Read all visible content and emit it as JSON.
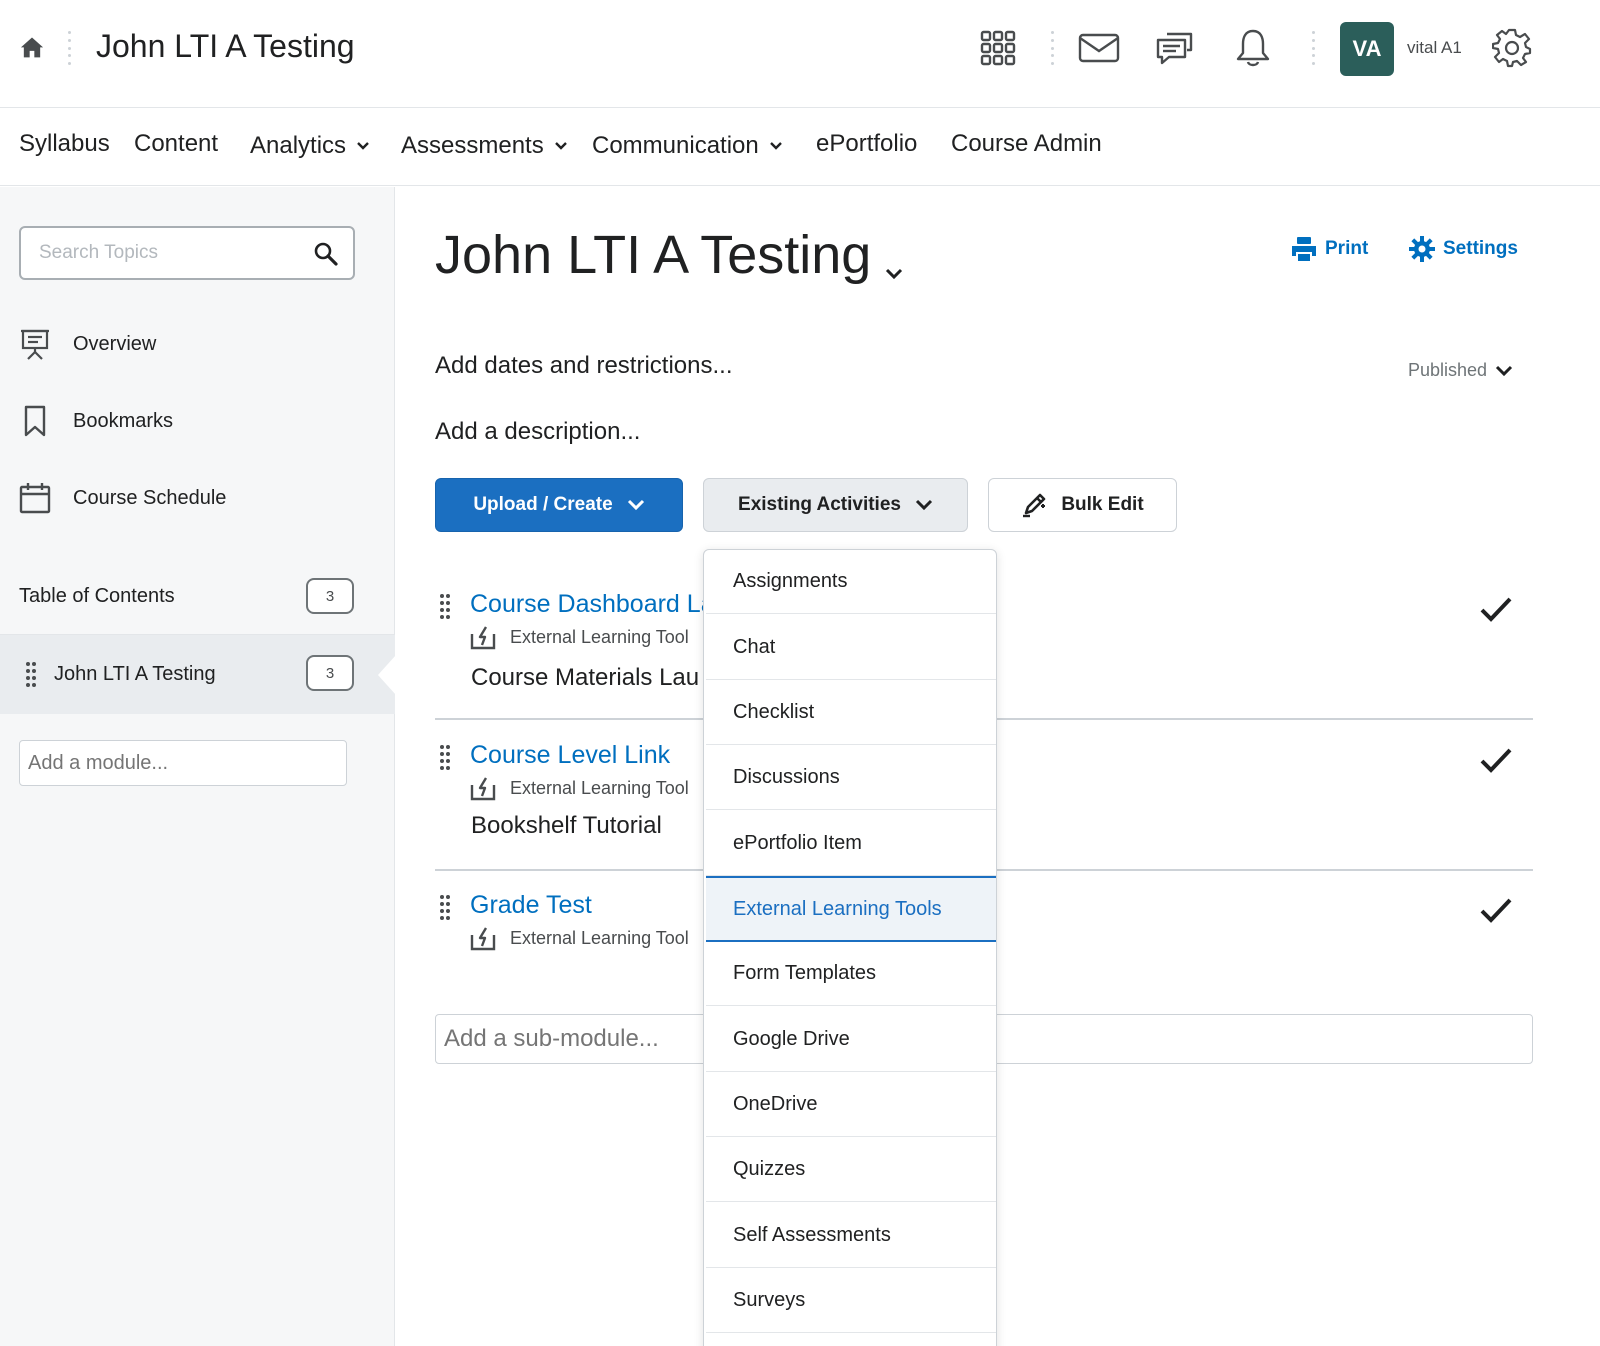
{
  "header": {
    "course_title": "John LTI A Testing",
    "avatar_initials": "VA",
    "user_name": "vital A1",
    "avatar_color": "#2b5e5a",
    "icons": [
      "home-icon",
      "waffle-grid-icon",
      "mail-icon",
      "chat-bubbles-icon",
      "bell-icon",
      "gear-icon"
    ]
  },
  "nav": {
    "syllabus": "Syllabus",
    "content": "Content",
    "analytics": "Analytics",
    "assessments": "Assessments",
    "communication": "Communication",
    "eportfolio": "ePortfolio",
    "course_admin": "Course Admin"
  },
  "sidebar": {
    "search_placeholder": "Search Topics",
    "overview": "Overview",
    "bookmarks": "Bookmarks",
    "course_schedule": "Course Schedule",
    "toc_label": "Table of Contents",
    "toc_count": "3",
    "module_name": "John LTI A Testing",
    "module_count": "3",
    "add_module_placeholder": "Add a module..."
  },
  "main": {
    "title": "John LTI A Testing",
    "print_label": "Print",
    "settings_label": "Settings",
    "dates_link": "Add dates and restrictions...",
    "description_link": "Add a description...",
    "status": "Published",
    "upload_create": "Upload / Create",
    "existing_activities": "Existing Activities",
    "bulk_edit": "Bulk Edit",
    "accent_color": "#006fbf",
    "topics": [
      {
        "title": "Course Dashboard La",
        "type": "External Learning Tool",
        "description": "Course Materials Lau"
      },
      {
        "title": "Course Level Link",
        "type": "External Learning Tool",
        "description": "Bookshelf Tutorial"
      },
      {
        "title": "Grade Test",
        "type": "External Learning Tool",
        "description": ""
      }
    ],
    "add_submodule_placeholder": "Add a sub-module..."
  },
  "dropdown": {
    "items": [
      "Assignments",
      "Chat",
      "Checklist",
      "Discussions",
      "ePortfolio Item",
      "External Learning Tools",
      "Form Templates",
      "Google Drive",
      "OneDrive",
      "Quizzes",
      "Self Assessments",
      "Surveys"
    ],
    "selected": "External Learning Tools"
  }
}
